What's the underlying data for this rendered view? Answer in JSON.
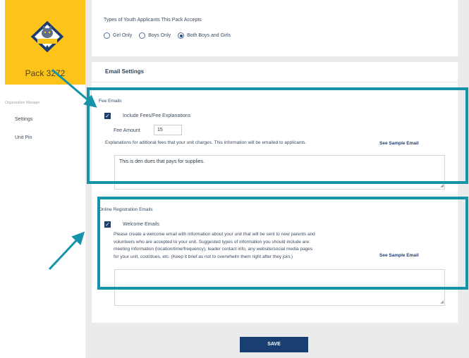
{
  "sidebar": {
    "pack_name": "Pack 3272",
    "logo_text": "CUB SCOUTS",
    "section_label": "Organization Manager",
    "items": [
      {
        "label": "Settings"
      },
      {
        "label": "Unit Pin"
      }
    ]
  },
  "youth": {
    "title": "Types of Youth Applicants This Pack Accepts",
    "options": [
      {
        "label": "Girl Only",
        "selected": false
      },
      {
        "label": "Boys Only",
        "selected": false
      },
      {
        "label": "Both Boys and Girls",
        "selected": true
      }
    ]
  },
  "email_settings": {
    "title": "Email Settings",
    "fee": {
      "section_title": "Fee Emails",
      "checkbox_label": "Include Fees/Fee Explanations",
      "checked": true,
      "amount_label": "Fee Amount",
      "amount_value": "15",
      "help": "Explanations for aditional fees that your unit charges. This information will be emailed to applicants.",
      "sample_link": "See Sample Email",
      "text": "This is den dues that pays for supplies."
    },
    "online": {
      "section_title": "Online Registration Emails",
      "checkbox_label": "Welcome Emails",
      "checked": true,
      "help_lines": [
        "Please create a welcome email with information about your unit that will be sent to new parents and",
        "volunteers who are accepted to your unit. Suggested types of information you should include are:",
        "meeting information (location/time/frequency), leader contact info, any website/social media pages",
        "for your unit, cost/dues, etc. (Keep it brief as not to overwhelm them right after they join.)"
      ],
      "sample_link": "See Sample Email",
      "text": ""
    }
  },
  "save_label": "SAVE",
  "colors": {
    "brand_yellow": "#fcc31a",
    "navy": "#183e72",
    "highlight_teal": "#1493a9",
    "page_bg": "#ebebeb"
  }
}
